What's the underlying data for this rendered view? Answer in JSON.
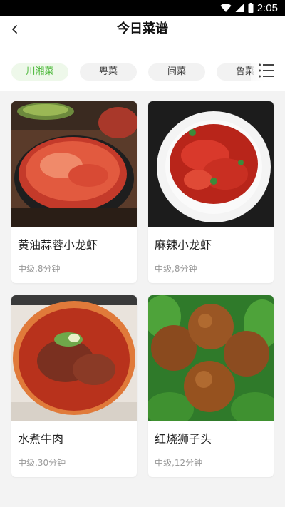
{
  "status_bar": {
    "time": "2:05",
    "icons": [
      "wifi-icon",
      "cell-signal-icon",
      "battery-icon"
    ]
  },
  "header": {
    "title": "今日菜谱",
    "back_icon": "chevron-left-icon"
  },
  "tabs": {
    "items": [
      {
        "label": "川湘菜",
        "active": true
      },
      {
        "label": "粤菜",
        "active": false
      },
      {
        "label": "闽菜",
        "active": false
      },
      {
        "label": "鲁菜",
        "active": false
      }
    ],
    "menu_icon": "list-menu-icon"
  },
  "colors": {
    "accent": "#4cb83a",
    "tab_active_bg": "#eef8ea",
    "page_bg": "#f3f3f3"
  },
  "recipes": [
    {
      "name": "黄油蒜蓉小龙虾",
      "meta": "中级,8分钟"
    },
    {
      "name": "麻辣小龙虾",
      "meta": "中级,8分钟"
    },
    {
      "name": "水煮牛肉",
      "meta": "中级,30分钟"
    },
    {
      "name": "红烧狮子头",
      "meta": "中级,12分钟"
    }
  ]
}
